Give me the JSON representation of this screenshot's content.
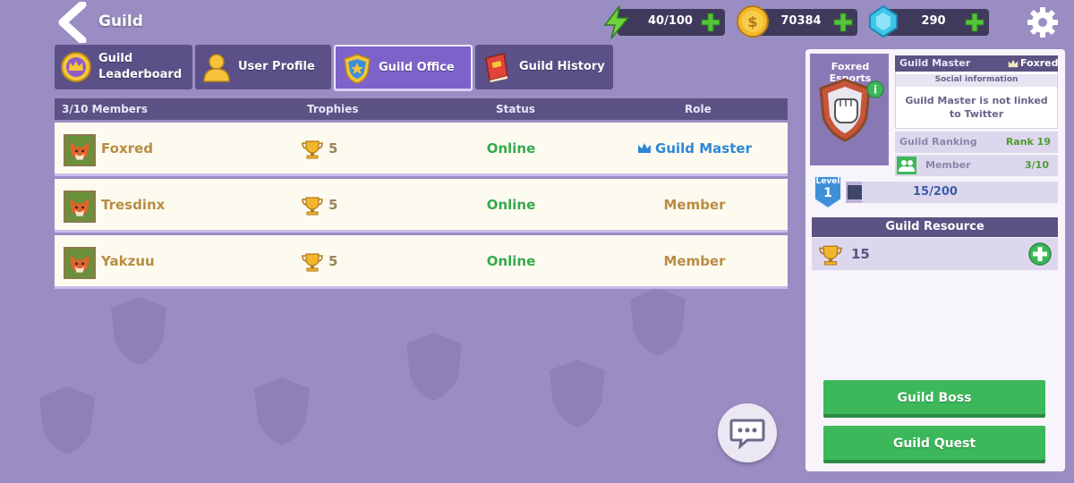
{
  "header": {
    "title": "Guild",
    "energy": "40/100",
    "coins": "70384",
    "gems": "290"
  },
  "tabs": [
    {
      "label": "Guild\nLeaderboard"
    },
    {
      "label": "User Profile"
    },
    {
      "label": "Guild Office"
    },
    {
      "label": "Guild History"
    }
  ],
  "table": {
    "headers": {
      "members": "3/10 Members",
      "trophies": "Trophies",
      "status": "Status",
      "role": "Role"
    },
    "rows": [
      {
        "name": "Foxred",
        "trophies": "5",
        "status": "Online",
        "role": "Guild Master"
      },
      {
        "name": "Tresdinx",
        "trophies": "5",
        "status": "Online",
        "role": "Member"
      },
      {
        "name": "Yakzuu",
        "trophies": "5",
        "status": "Online",
        "role": "Member"
      }
    ]
  },
  "guild": {
    "name": "Foxred Esports",
    "master_label": "Guild Master",
    "master_name": "Foxred",
    "social_title": "Social information",
    "social_text": "Guild Master is not linked to Twitter",
    "ranking_label": "Guild Ranking",
    "ranking_value": "Rank 19",
    "member_label": "Member",
    "member_value": "3/10",
    "level_label": "Level",
    "level_value": "1",
    "level_progress": "15/200",
    "level_fraction": 0.075,
    "info_badge": "i"
  },
  "resource": {
    "title": "Guild Resource",
    "value": "15"
  },
  "buttons": {
    "boss": "Guild Boss",
    "quest": "Guild Quest"
  },
  "colors": {
    "background": "#9a8dc3",
    "online": "#36a94f",
    "master_role": "#2f86d6",
    "button_green": "#3cb85a"
  }
}
